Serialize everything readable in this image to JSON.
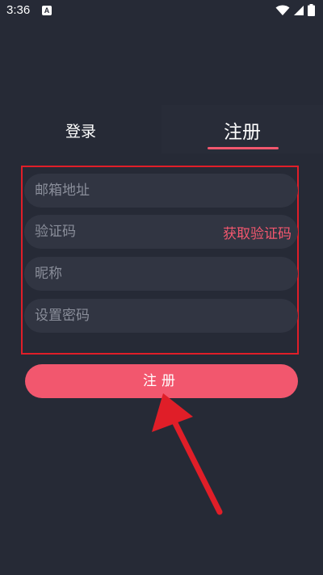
{
  "status_bar": {
    "time": "3:36",
    "notification_icon": "a-icon",
    "a_icon_letter": "A",
    "icons": [
      "wifi-icon",
      "signal-icon",
      "battery-icon"
    ]
  },
  "tabs": {
    "login_label": "登录",
    "register_label": "注册",
    "active": "register"
  },
  "form": {
    "email_placeholder": "邮箱地址",
    "code_placeholder": "验证码",
    "get_code_label": "获取验证码",
    "nickname_placeholder": "昵称",
    "password_placeholder": "设置密码"
  },
  "register_button_label": "注册",
  "colors": {
    "background": "#262a36",
    "field_background": "#313542",
    "accent": "#f2576e",
    "annotation": "#e01e28"
  }
}
